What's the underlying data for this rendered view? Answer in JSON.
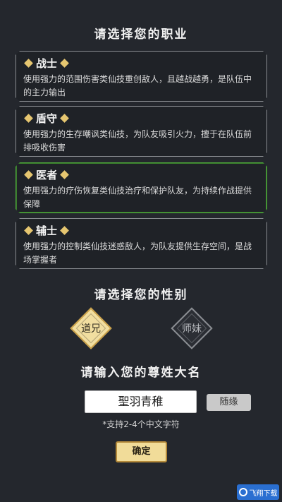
{
  "profession": {
    "title": "请选择您的职业",
    "options": [
      {
        "name": "战士",
        "desc": "使用强力的范围伤害类仙技重创敌人，且越战越勇，是队伍中的主力输出",
        "selected": false
      },
      {
        "name": "盾守",
        "desc": "使用强力的生存嘲讽类仙技，为队友吸引火力，擅于在队伍前排吸收伤害",
        "selected": false
      },
      {
        "name": "医者",
        "desc": "使用强力的疗伤恢复类仙技治疗和保护队友，为持续作战提供保障",
        "selected": true
      },
      {
        "name": "辅士",
        "desc": "使用强力的控制类仙技迷惑敌人，为队友提供生存空间，是战场掌握者",
        "selected": false
      }
    ]
  },
  "gender": {
    "title": "请选择您的性别",
    "male_label": "道兄",
    "female_label": "师妹",
    "selected": "male"
  },
  "name": {
    "title": "请输入您的尊姓大名",
    "value": "聖羽青稚",
    "random_label": "随缘",
    "hint": "*支持2-4个中文字符"
  },
  "confirm_label": "确定",
  "watermark": {
    "text": "飞翔下载"
  },
  "colors": {
    "accent_gold": "#e6c670",
    "selected_border": "#4fa93d",
    "background": "#24272d"
  }
}
